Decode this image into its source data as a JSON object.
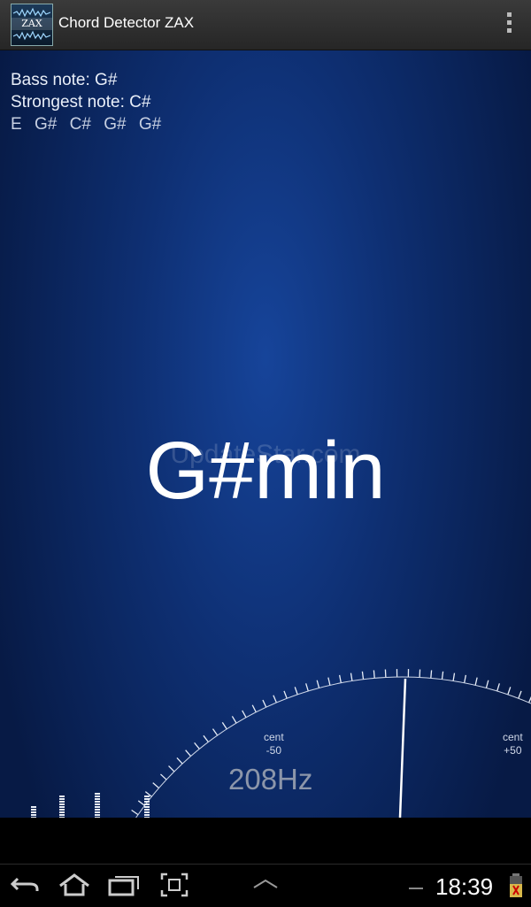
{
  "app": {
    "title": "Chord Detector ZAX",
    "icon_text": "ZAX"
  },
  "info": {
    "bass_note": "Bass note: G#",
    "strongest_note": "Strongest note: C#",
    "detected_notes": [
      "E",
      "G#",
      "C#",
      "G#",
      "G#"
    ]
  },
  "chord": "G#min",
  "watermark": "UpdateStar.com",
  "tuner": {
    "left_label_1": "cent",
    "left_label_2": "-50",
    "right_label_1": "cent",
    "right_label_2": "+50",
    "frequency": "208Hz"
  },
  "status": {
    "time": "18:39"
  },
  "icons": {
    "back": "back-icon",
    "home": "home-icon",
    "recents": "recent-apps-icon",
    "screenshot": "screenshot-icon",
    "up": "chevron-up-icon",
    "overflow": "overflow-menu-icon",
    "battery": "battery-icon"
  },
  "colors": {
    "background_center": "#16449a",
    "background_edge": "#071a45",
    "needle": "#ffffff",
    "center_mark": "#7fd0ff"
  }
}
